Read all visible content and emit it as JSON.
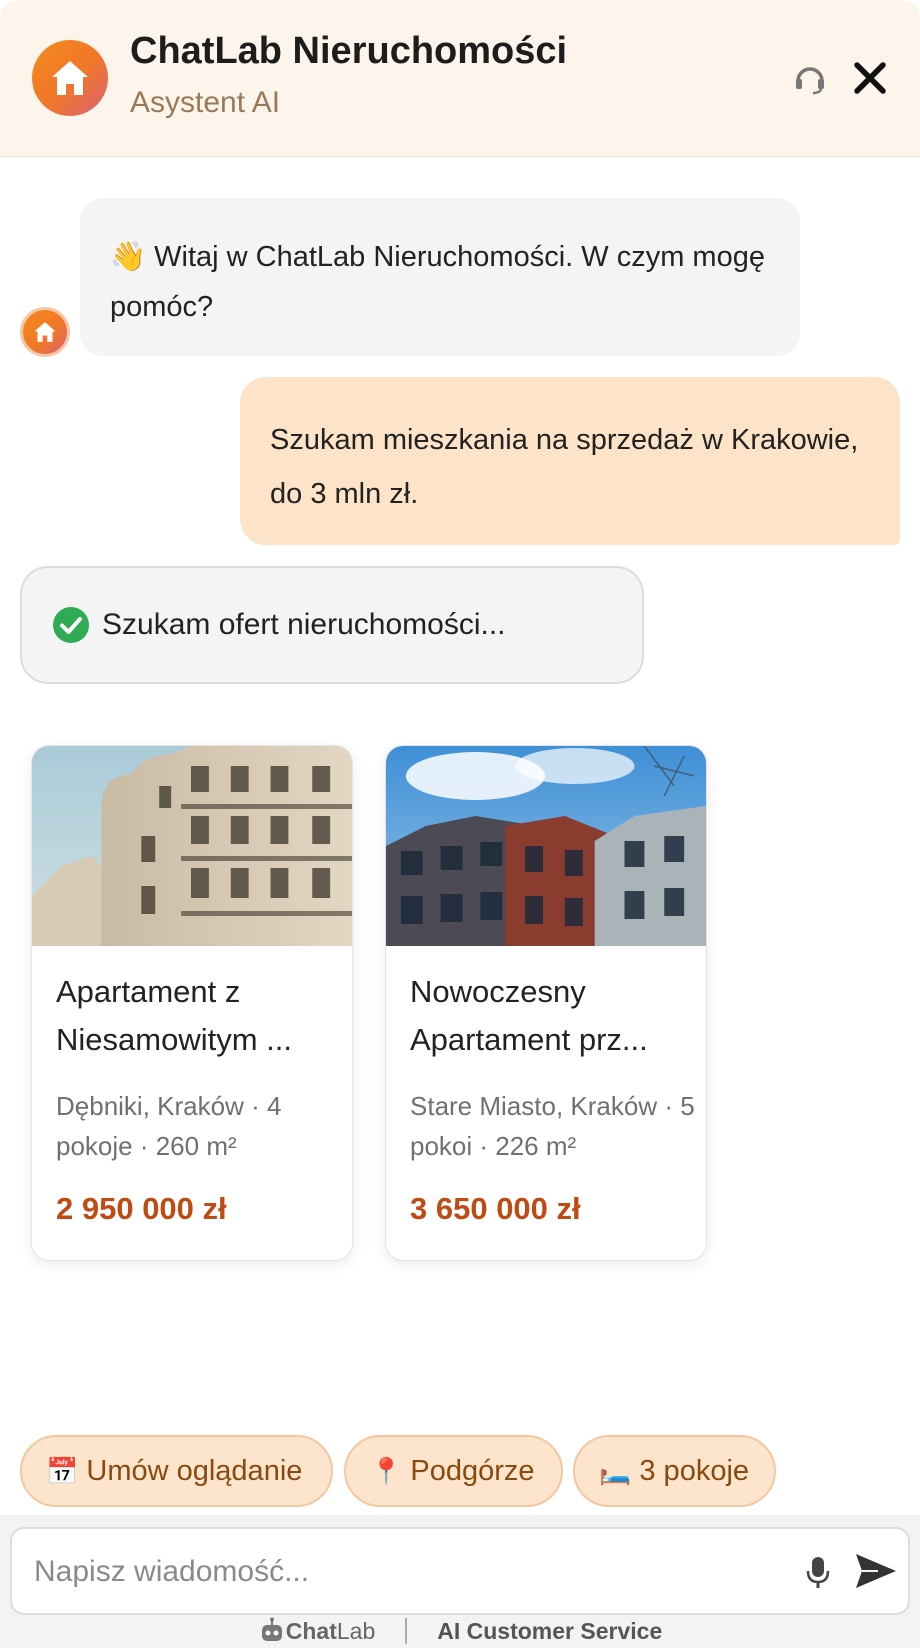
{
  "header": {
    "title": "ChatLab Nieruchomości",
    "subtitle": "Asystent AI",
    "logo_icon": "house-icon",
    "support_icon": "headset-icon",
    "close_icon": "close-icon"
  },
  "messages": {
    "bot_greeting": "👋 Witaj w ChatLab Nieruchomości. W czym mogę pomóc?",
    "user_message": "Szukam mieszkania na sprzedaż w Krakowie, do 3 mln zł.",
    "status": "Szukam ofert nieruchomości..."
  },
  "listings": [
    {
      "title_line1": "Apartament z",
      "title_line2": "Niesamowitym ...",
      "meta": "Dębniki, Kraków · 4 pokoje · 260 m²",
      "price": "2 950 000 zł"
    },
    {
      "title_line1": "Nowoczesny",
      "title_line2": "Apartament prz...",
      "meta": "Stare Miasto, Kraków · 5 pokoi · 226 m²",
      "price": "3 650 000 zł"
    }
  ],
  "quick_replies": [
    {
      "icon": "📅",
      "label": "Umów oglądanie"
    },
    {
      "icon": "📍",
      "label": "Podgórze"
    },
    {
      "icon": "🛏️",
      "label": "3 pokoje"
    }
  ],
  "composer": {
    "placeholder": "Napisz wiadomość...",
    "mic_icon": "microphone-icon",
    "send_icon": "send-icon"
  },
  "footer": {
    "brand_chat": "Chat",
    "brand_lab": "Lab",
    "tagline": "AI Customer Service"
  },
  "colors": {
    "accent": "#f58a1c",
    "header_bg": "#fdf5ec",
    "user_bubble": "#fde3c8",
    "price": "#bf4a12",
    "chip_bg": "#fde4cc",
    "success": "#2faa55"
  }
}
